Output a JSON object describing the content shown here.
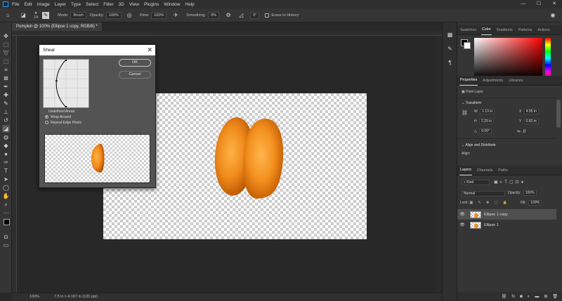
{
  "menu": [
    "File",
    "Edit",
    "Image",
    "Layer",
    "Type",
    "Select",
    "Filter",
    "3D",
    "View",
    "Plugins",
    "Window",
    "Help"
  ],
  "window_controls": {
    "minimize": "—",
    "maximize": "☐",
    "close": "✕"
  },
  "options_bar": {
    "brush_size": "14",
    "mode_label": "Mode:",
    "mode_value": "Brush",
    "opacity_label": "Opacity:",
    "opacity_value": "100%",
    "flow_label": "Flow:",
    "flow_value": "100%",
    "smoothing_label": "Smoothing:",
    "smoothing_value": "0%",
    "angle_value": "0°",
    "erase_history_label": "Erase to History"
  },
  "document_tab": "Pumpkin @ 100% (Ellipse 1 copy, RGB/8) *",
  "status": {
    "zoom": "100%",
    "doc_size": "7.5 in x 4.167 in (120 ppi)"
  },
  "colors": {
    "accent": "#2fa3f7",
    "orange": "#f08a1c",
    "orange_dark": "#c95f00"
  },
  "dialog": {
    "title": "Shear",
    "ok_label": "OK",
    "cancel_label": "Cancel",
    "undefined_areas_label": "Undefined Areas:",
    "wrap_around_label": "Wrap Around",
    "repeat_edge_label": "Repeat Edge Pixels",
    "selected_option": "wrap-around"
  },
  "panels": {
    "color_tabs": [
      "Swatches",
      "Color",
      "Gradients",
      "Patterns",
      "Actions"
    ],
    "color_tab_active": "Color",
    "properties_tabs": [
      "Properties",
      "Adjustments",
      "Libraries"
    ],
    "properties_tab_active": "Properties",
    "layer_kind": "Pixel Layer",
    "transform_label": "Transform",
    "w": "1.13 in",
    "h": "2.29 in",
    "x": "4.55 in",
    "y": "0.83 in",
    "angle": "0.00°",
    "align_label": "Align and Distribute",
    "align_sub": "Align:",
    "layers_tabs": [
      "Layers",
      "Channels",
      "Paths"
    ],
    "layers_tab_active": "Layers",
    "filter_kind": "Kind",
    "blend_mode": "Normal",
    "opacity_label": "Opacity:",
    "opacity_value": "100%",
    "lock_label": "Lock:",
    "fill_label": "Fill:",
    "fill_value": "100%",
    "layers": [
      {
        "name": "Ellipse 1 copy",
        "selected": true
      },
      {
        "name": "Ellipse 1",
        "selected": false
      }
    ]
  }
}
